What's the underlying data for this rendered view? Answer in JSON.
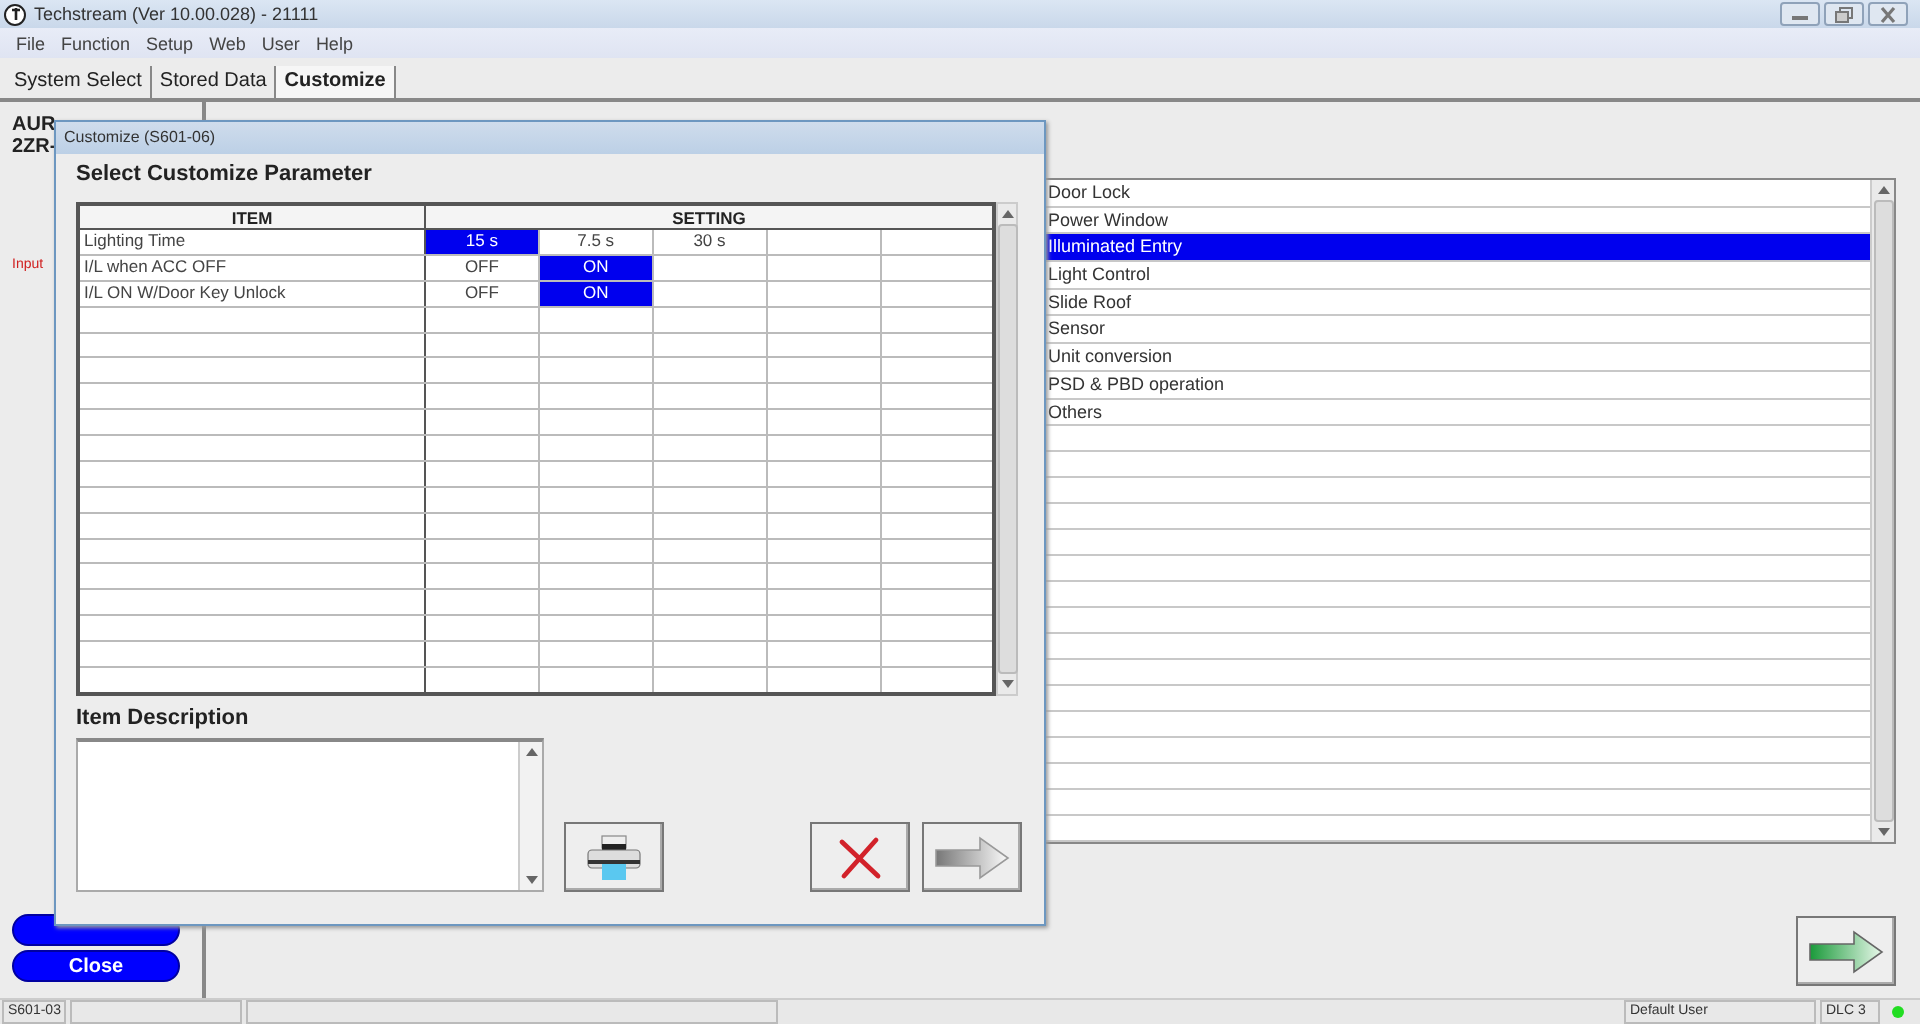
{
  "window": {
    "title": "Techstream (Ver 10.00.028) - 21111"
  },
  "menu": [
    "File",
    "Function",
    "Setup",
    "Web",
    "User",
    "Help"
  ],
  "tabs": [
    {
      "label": "System Select",
      "selected": false
    },
    {
      "label": "Stored Data",
      "selected": false
    },
    {
      "label": "Customize",
      "selected": true
    }
  ],
  "left_panel": {
    "vehicle_lines": [
      "AUR",
      "2ZR-"
    ],
    "input_label": "Input",
    "close_button": "Close"
  },
  "system_list": [
    {
      "label": "Door Lock",
      "selected": false
    },
    {
      "label": "Power Window",
      "selected": false
    },
    {
      "label": "Illuminated Entry",
      "selected": true
    },
    {
      "label": "Light Control",
      "selected": false
    },
    {
      "label": "Slide Roof",
      "selected": false
    },
    {
      "label": "Sensor",
      "selected": false
    },
    {
      "label": "Unit conversion",
      "selected": false
    },
    {
      "label": "PSD & PBD operation",
      "selected": false
    },
    {
      "label": "Others",
      "selected": false
    }
  ],
  "dialog": {
    "title": "Customize (S601-06)",
    "heading": "Select Customize Parameter",
    "columns": [
      "ITEM",
      "SETTING"
    ],
    "rows": [
      {
        "item": "Lighting Time",
        "settings": [
          {
            "label": "15 s",
            "selected": true
          },
          {
            "label": "7.5 s",
            "selected": false
          },
          {
            "label": "30 s",
            "selected": false
          }
        ]
      },
      {
        "item": "I/L when ACC OFF",
        "settings": [
          {
            "label": "OFF",
            "selected": false
          },
          {
            "label": "ON",
            "selected": true
          }
        ]
      },
      {
        "item": "I/L ON W/Door Key Unlock",
        "settings": [
          {
            "label": "OFF",
            "selected": false
          },
          {
            "label": "ON",
            "selected": true
          }
        ]
      }
    ],
    "description_label": "Item Description"
  },
  "status_bar": {
    "screen_code": "S601-03",
    "user": "Default User",
    "connection": "DLC 3"
  }
}
